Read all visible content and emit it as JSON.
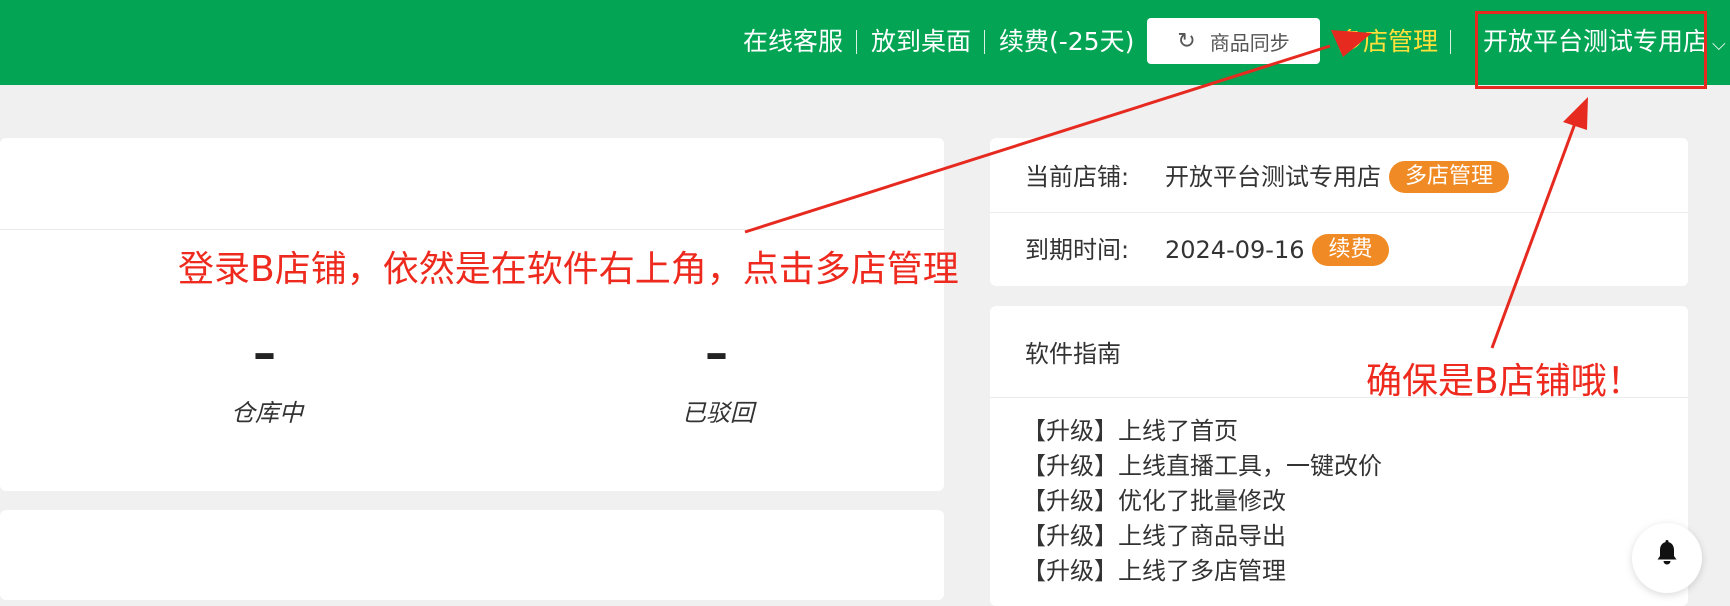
{
  "header": {
    "online_service": "在线客服",
    "put_desktop": "放到桌面",
    "renew": "续费(-25天)",
    "sync_button": "商品同步",
    "multi_store": "多店管理",
    "current_shop": "开放平台测试专用店"
  },
  "stats": [
    {
      "value": "–",
      "label": "仓库中"
    },
    {
      "value": "–",
      "label": "已驳回"
    }
  ],
  "store_info": {
    "current_label": "当前店铺:",
    "current_value": "开放平台测试专用店",
    "current_badge": "多店管理",
    "expire_label": "到期时间:",
    "expire_value": "2024-09-16",
    "expire_badge": "续费"
  },
  "guide": {
    "title": "软件指南",
    "items": [
      "【升级】上线了首页",
      "【升级】上线直播工具，一键改价",
      "【升级】优化了批量修改",
      "【升级】上线了商品导出",
      "【升级】上线了多店管理"
    ]
  },
  "annotations": {
    "left": "登录B店铺，依然是在软件右上角，点击多店管理",
    "right": "确保是B店铺哦！",
    "color": "#ee2a1f"
  },
  "colors": {
    "header_bg": "#04a455",
    "multi_store_link": "#ffe13a",
    "badge": "#f08a24"
  },
  "icons": [
    "sync-icon",
    "chevron-down-icon",
    "bell-icon"
  ]
}
